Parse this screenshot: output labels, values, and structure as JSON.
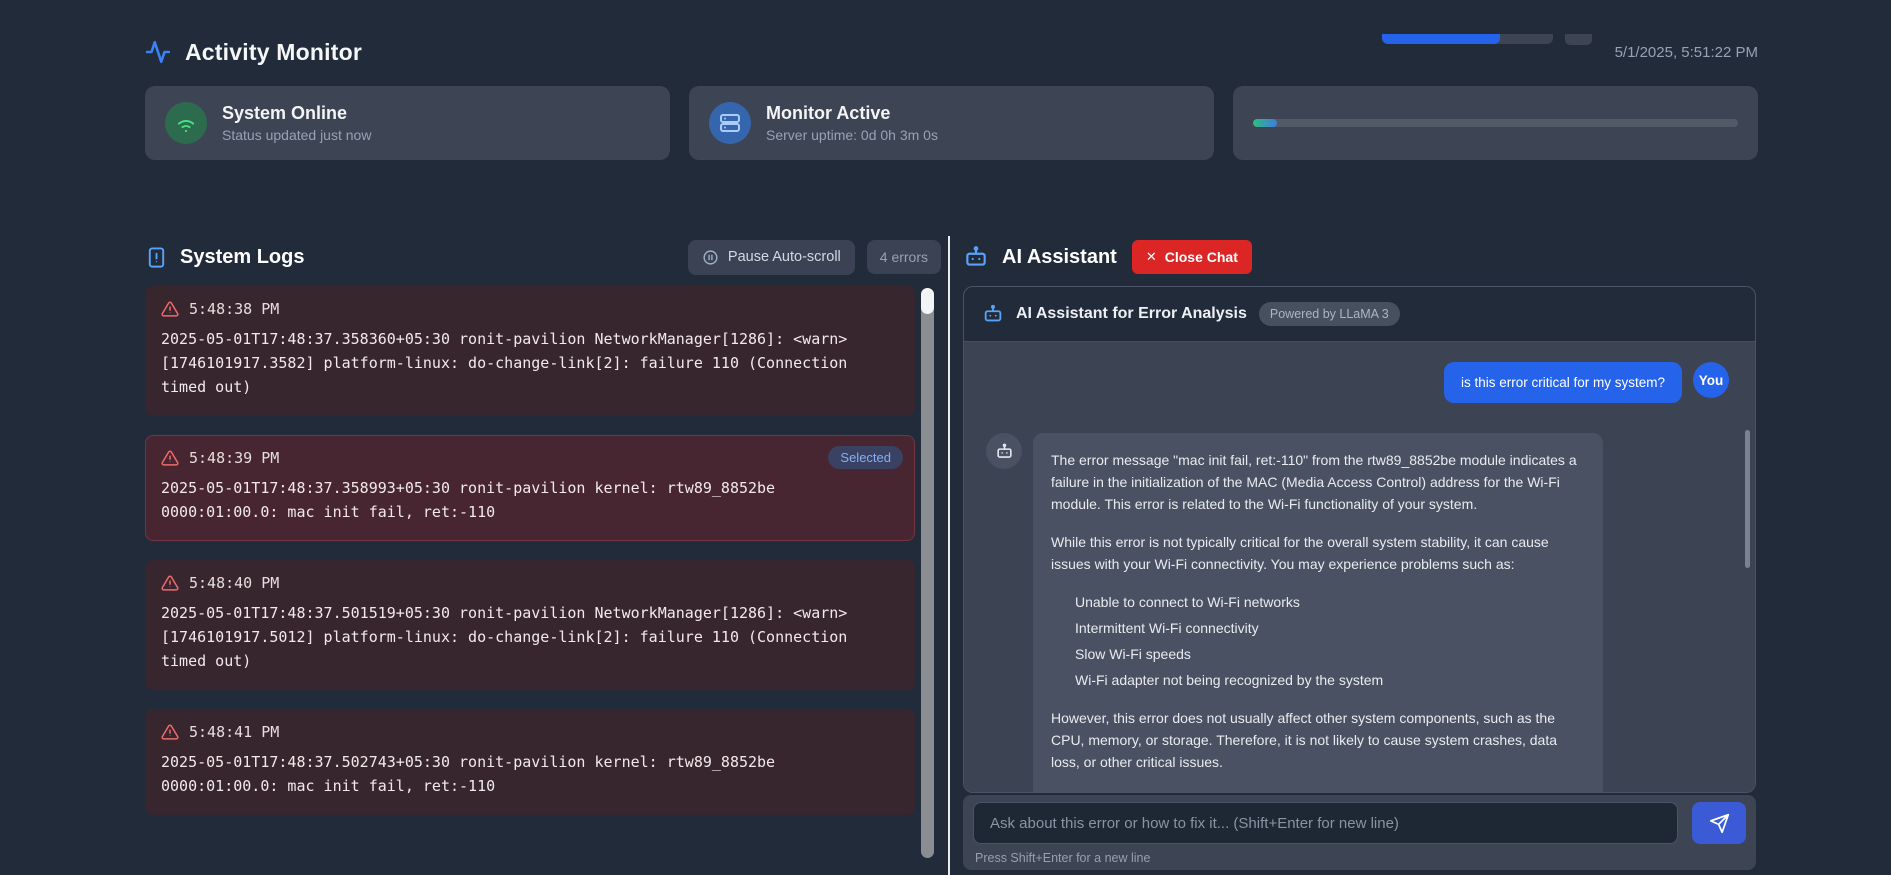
{
  "header": {
    "title": "Activity Monitor",
    "timestamp": "5/1/2025, 5:51:22 PM"
  },
  "status_cards": [
    {
      "icon": "wifi-icon",
      "title": "System Online",
      "subtitle": "Status updated just now"
    },
    {
      "icon": "server-icon",
      "title": "Monitor Active",
      "subtitle": "Server uptime: 0d 0h 3m 0s"
    },
    {
      "icon": "progress-bar",
      "progress_percent": 5
    }
  ],
  "logs": {
    "title": "System Logs",
    "pause_button_label": "Pause Auto-scroll",
    "error_count_label": "4 errors",
    "selected_badge_label": "Selected",
    "entries": [
      {
        "time": "5:48:38 PM",
        "selected": false,
        "message": "2025-05-01T17:48:37.358360+05:30 ronit-pavilion NetworkManager[1286]: <warn> [1746101917.3582] platform-linux: do-change-link[2]: failure 110 (Connection timed out)"
      },
      {
        "time": "5:48:39 PM",
        "selected": true,
        "message": "2025-05-01T17:48:37.358993+05:30 ronit-pavilion kernel: rtw89_8852be 0000:01:00.0: mac init fail, ret:-110"
      },
      {
        "time": "5:48:40 PM",
        "selected": false,
        "message": "2025-05-01T17:48:37.501519+05:30 ronit-pavilion NetworkManager[1286]: <warn> [1746101917.5012] platform-linux: do-change-link[2]: failure 110 (Connection timed out)"
      },
      {
        "time": "5:48:41 PM",
        "selected": false,
        "message": "2025-05-01T17:48:37.502743+05:30 ronit-pavilion kernel: rtw89_8852be 0000:01:00.0: mac init fail, ret:-110"
      }
    ]
  },
  "assistant": {
    "title": "AI Assistant",
    "close_button_label": "Close Chat",
    "card_title": "AI Assistant for Error Analysis",
    "powered_by_label": "Powered by LLaMA 3",
    "user_message": {
      "sender_label": "You",
      "text": "is this error critical for my system?"
    },
    "bot_message": {
      "paragraph_1": "The error message \"mac init fail, ret:-110\" from the rtw89_8852be module indicates a failure in the initialization of the MAC (Media Access Control) address for the Wi-Fi module. This error is related to the Wi-Fi functionality of your system.",
      "paragraph_2": "While this error is not typically critical for the overall system stability, it can cause issues with your Wi-Fi connectivity. You may experience problems such as:",
      "bullets": [
        "Unable to connect to Wi-Fi networks",
        "Intermittent Wi-Fi connectivity",
        "Slow Wi-Fi speeds",
        "Wi-Fi adapter not being recognized by the system"
      ],
      "paragraph_3": "However, this error does not usually affect other system components, such as the CPU, memory, or storage. Therefore, it is not likely to cause system crashes, data loss, or other critical issues."
    },
    "input_placeholder": "Ask about this error or how to fix it... (Shift+Enter for new line)",
    "input_hint": "Press Shift+Enter for a new line"
  },
  "colors": {
    "accent_blue": "#2563eb",
    "error_red": "#dc2626",
    "success_green": "#34d399",
    "warning_icon_red": "#f06a6a"
  }
}
